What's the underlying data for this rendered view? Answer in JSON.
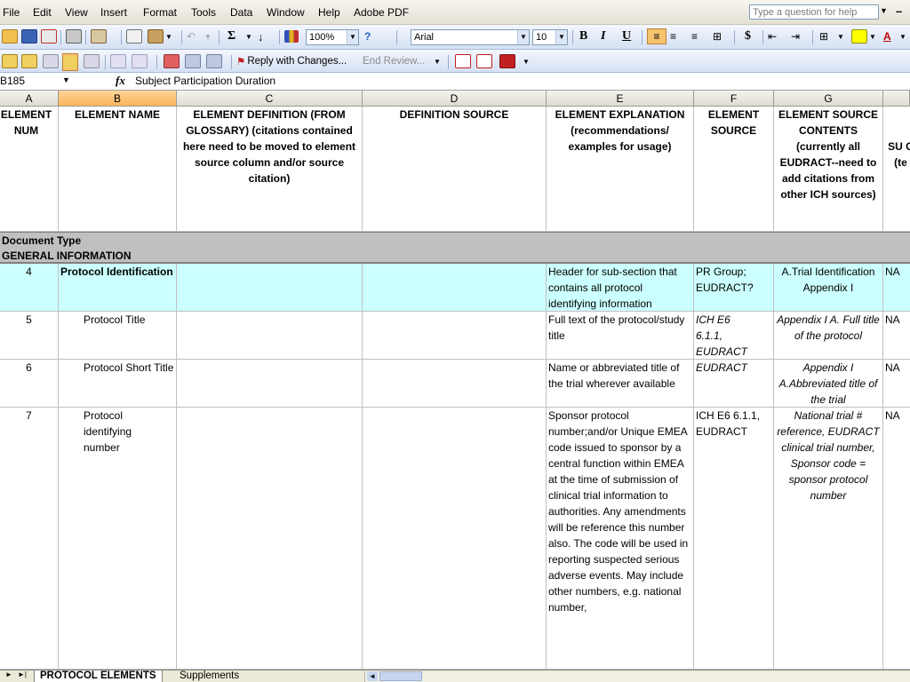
{
  "menubar": {
    "items": [
      "File",
      "Edit",
      "View",
      "Insert",
      "Format",
      "Tools",
      "Data",
      "Window",
      "Help",
      "Adobe PDF"
    ],
    "help_placeholder": "Type a question for help"
  },
  "toolbar": {
    "zoom": "100%",
    "font_name": "Arial",
    "font_size": "10",
    "sigma": "Σ",
    "bold": "B",
    "italic": "I",
    "underline": "U",
    "currency": "$",
    "reply_label": "Reply with Changes...",
    "end_review_label": "End Review..."
  },
  "formula_bar": {
    "name_box": "B185",
    "fx": "fx",
    "formula": "Subject Participation Duration"
  },
  "columns": [
    "A",
    "B",
    "C",
    "D",
    "E",
    "F",
    "G"
  ],
  "header_row": {
    "a": "ELEMENT NUM",
    "b": "ELEMENT NAME",
    "c": "ELEMENT DEFINITION (FROM GLOSSARY) (citations contained here need to be moved to element source column and/or source citation)",
    "d": "DEFINITION SOURCE",
    "e": "ELEMENT EXPLANATION (recommendations/ examples for usage)",
    "f": "ELEMENT SOURCE",
    "g": "ELEMENT SOURCE CONTENTS (currently all EUDRACT--need to add citations from other ICH sources)",
    "h": "SU C (te"
  },
  "bands": [
    "Document Type",
    "GENERAL INFORMATION"
  ],
  "rows": [
    {
      "num": "4",
      "name": "Protocol Identification",
      "expl": "Header for sub-section that contains all protocol identifying information",
      "src": "PR Group; EUDRACT?",
      "contents": "A.Trial Identification Appendix I",
      "h": "NA"
    },
    {
      "num": "5",
      "name": "Protocol Title",
      "expl": "Full text of the protocol/study title",
      "src": "ICH E6 6.1.1, EUDRACT",
      "contents": "Appendix I A. Full title of the protocol",
      "h": "NA"
    },
    {
      "num": "6",
      "name": "Protocol Short Title",
      "expl": "Name or abbreviated title of the trial wherever available",
      "src": "EUDRACT",
      "contents": "Appendix I A.Abbreviated title of the trial",
      "h": "NA"
    },
    {
      "num": "7",
      "name": "Protocol identifying number",
      "expl": "Sponsor protocol number;and/or Unique EMEA code issued to sponsor by a central function within EMEA at the time of submission of clinical trial information to authorities. Any amendments will be reference this number also. The code will be used in reporting suspected serious adverse events. May include other numbers, e.g. national number,",
      "src": "ICH E6 6.1.1, EUDRACT",
      "contents": "National trial # reference, EUDRACT clinical trial number, Sponsor code = sponsor protocol number",
      "h": "NA"
    }
  ],
  "sheet_tabs": [
    "PROTOCOL ELEMENTS",
    "Supplements"
  ]
}
